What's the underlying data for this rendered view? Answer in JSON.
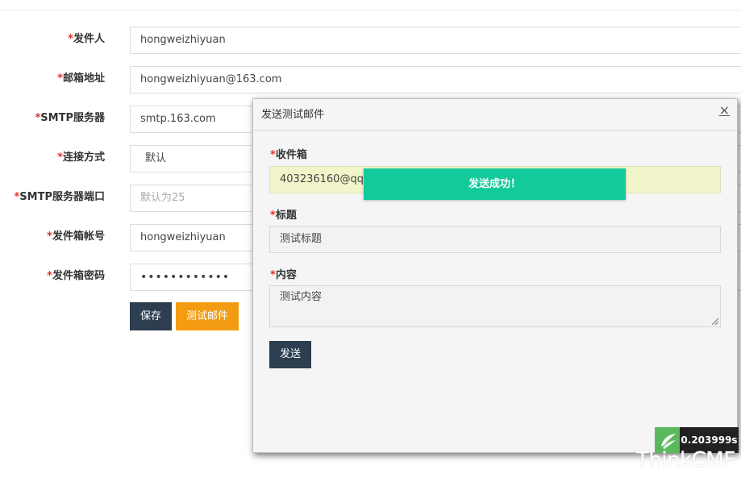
{
  "form": {
    "required_mark": "*",
    "fields": [
      {
        "label": "发件人",
        "value": "hongweizhiyuan"
      },
      {
        "label": "邮箱地址",
        "value": "hongweizhiyuan@163.com"
      },
      {
        "label": "SMTP服务器",
        "value": "smtp.163.com"
      },
      {
        "label": "连接方式",
        "value": "默认"
      },
      {
        "label": "SMTP服务器端口",
        "placeholder": "默认为25"
      },
      {
        "label": "发件箱帐号",
        "value": "hongweizhiyuan"
      },
      {
        "label": "发件箱密码",
        "value": "••••••••••••"
      }
    ],
    "save_label": "保存",
    "test_label": "测试邮件"
  },
  "modal": {
    "title": "发送测试邮件",
    "close": "×",
    "recipient_label": "收件箱",
    "recipient_value": "403236160@qq.co",
    "subject_label": "标题",
    "subject_value": "测试标题",
    "content_label": "内容",
    "content_value": "测试内容",
    "send_label": "发送"
  },
  "toast": {
    "message": "发送成功！"
  },
  "debug": {
    "time": "0.203999s",
    "brand": "ThinkCMF"
  },
  "colors": {
    "required": "#e0312b",
    "dark_button": "#2c3e50",
    "orange_button": "#f39c12",
    "toast": "#13ca9b"
  }
}
